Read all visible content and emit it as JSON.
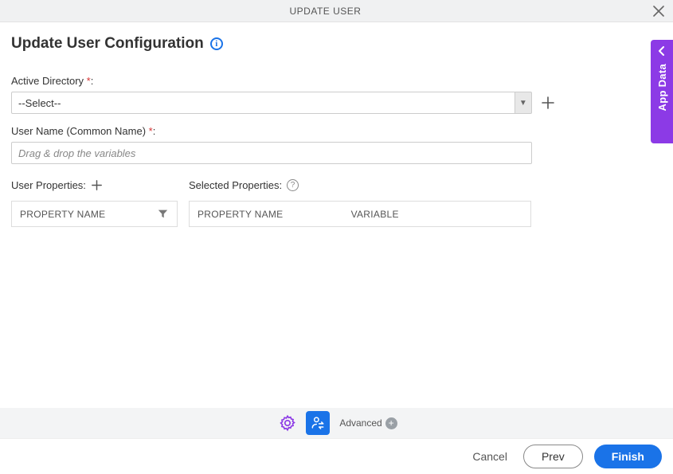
{
  "header": {
    "title": "UPDATE USER"
  },
  "page_title": "Update User Configuration",
  "fields": {
    "active_directory": {
      "label": "Active Directory",
      "value": "--Select--"
    },
    "user_name": {
      "label": "User Name (Common Name)",
      "placeholder": "Drag & drop the variables"
    }
  },
  "panels": {
    "user_properties": {
      "title": "User Properties:",
      "col1": "PROPERTY NAME"
    },
    "selected_properties": {
      "title": "Selected Properties:",
      "col1": "PROPERTY NAME",
      "col2": "VARIABLE"
    }
  },
  "side_tab": {
    "label": "App Data"
  },
  "toolbar": {
    "advanced_label": "Advanced"
  },
  "footer": {
    "cancel": "Cancel",
    "prev": "Prev",
    "finish": "Finish"
  }
}
